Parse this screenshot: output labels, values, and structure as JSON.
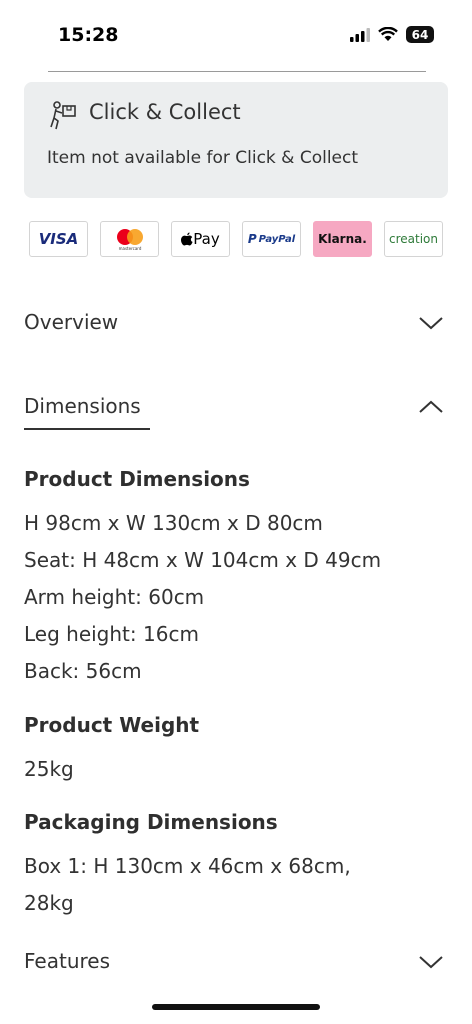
{
  "status": {
    "time": "15:28",
    "battery": "64"
  },
  "click_collect": {
    "title": "Click & Collect",
    "description": "Item not available for Click & Collect"
  },
  "payments": [
    "VISA",
    "mastercard",
    "Pay",
    "PayPal",
    "Klarna.",
    "creation"
  ],
  "accordion": {
    "overview": "Overview",
    "dimensions": "Dimensions",
    "features": "Features"
  },
  "dimensions": {
    "product_title": "Product Dimensions",
    "product_lines": [
      "H 98cm x W 130cm x D 80cm",
      "Seat: H 48cm x W 104cm x D 49cm",
      "Arm height: 60cm",
      "Leg height: 16cm",
      "Back: 56cm"
    ],
    "weight_title": "Product Weight",
    "weight_value": "25kg",
    "packaging_title": "Packaging Dimensions",
    "packaging_lines": [
      "Box 1: H 130cm x 46cm x 68cm,",
      "28kg"
    ]
  }
}
